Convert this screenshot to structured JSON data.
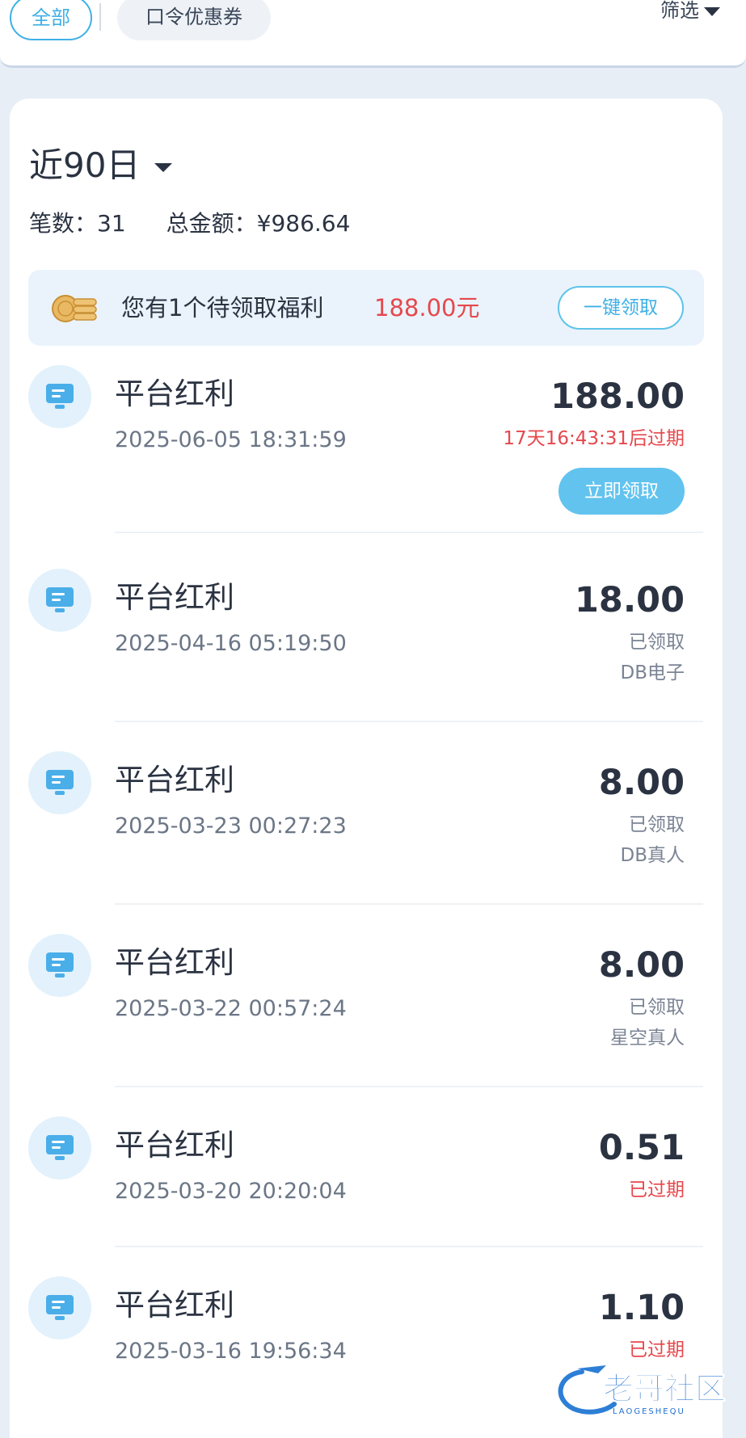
{
  "filter_bar": {
    "tab_all": "全部",
    "tab_coupon": "口令优惠券",
    "filter_label": "筛选"
  },
  "summary": {
    "period": "近90日",
    "count_label": "笔数：31",
    "total_label": "总金额：¥986.64"
  },
  "banner": {
    "text": "您有1个待领取福利",
    "amount": "188.00元",
    "claim_all": "一键领取"
  },
  "records": [
    {
      "title": "平台红利",
      "time": "2025-06-05 18:31:59",
      "amount": "188.00",
      "status": "17天16:43:31后过期",
      "action": "立即领取"
    },
    {
      "title": "平台红利",
      "time": "2025-04-16 05:19:50",
      "amount": "18.00",
      "status": "已领取",
      "platform": "DB电子"
    },
    {
      "title": "平台红利",
      "time": "2025-03-23 00:27:23",
      "amount": "8.00",
      "status": "已领取",
      "platform": "DB真人"
    },
    {
      "title": "平台红利",
      "time": "2025-03-22 00:57:24",
      "amount": "8.00",
      "status": "已领取",
      "platform": "星空真人"
    },
    {
      "title": "平台红利",
      "time": "2025-03-20 20:20:04",
      "amount": "0.51",
      "status": "已过期"
    },
    {
      "title": "平台红利",
      "time": "2025-03-16 19:56:34",
      "amount": "1.10",
      "status": "已过期"
    }
  ],
  "watermark": {
    "text": "老哥社区",
    "subtext": "LAOGESHEQU"
  },
  "colors": {
    "accent": "#3fb0e6",
    "red": "#e5484d",
    "icon_bg": "#e2f1fb"
  },
  "icons": {
    "record": "monitor-icon",
    "coins": "coins-icon"
  }
}
